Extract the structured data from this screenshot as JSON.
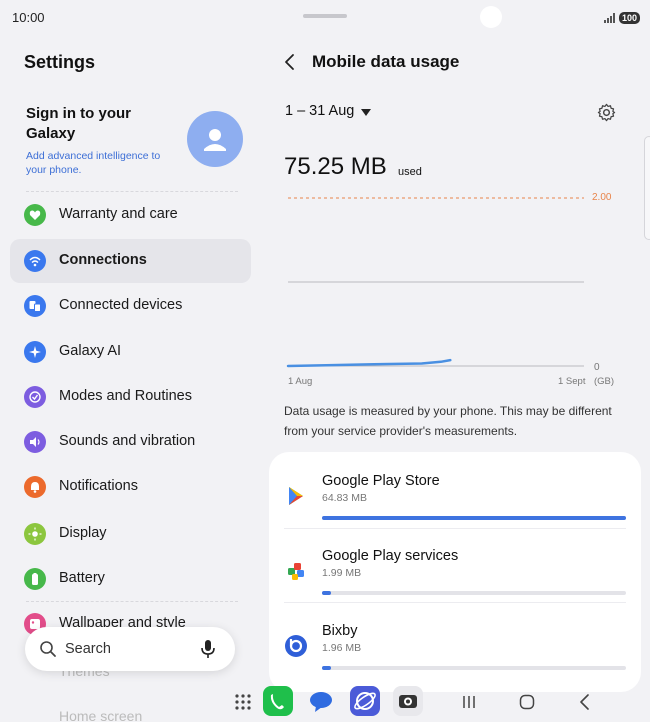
{
  "status_bar": {
    "time": "10:00",
    "battery": "100"
  },
  "left": {
    "title": "Settings",
    "account": {
      "title": "Sign in to your Galaxy",
      "subtitle": "Add advanced intelligence to your phone."
    },
    "menu": [
      {
        "label": "Warranty and care",
        "color": "#47b84a"
      },
      {
        "label": "Connections",
        "color": "#3a78ee",
        "selected": true
      },
      {
        "label": "Connected devices",
        "color": "#3a78ee"
      },
      {
        "label": "Galaxy AI",
        "color": "#3a78ee"
      },
      {
        "label": "Modes and Routines",
        "color": "#7d5de0"
      },
      {
        "label": "Sounds and vibration",
        "color": "#7d5de0"
      },
      {
        "label": "Notifications",
        "color": "#ec6a2c"
      },
      {
        "label": "Display",
        "color": "#8cc63e"
      },
      {
        "label": "Battery",
        "color": "#47b84a"
      },
      {
        "label": "Wallpaper and style",
        "color": "#e24d8a"
      }
    ],
    "faded_items": [
      "Themes",
      "Home screen"
    ],
    "search": {
      "placeholder": "Search"
    }
  },
  "right": {
    "title": "Mobile data usage",
    "date_range": "1 – 31 Aug",
    "usage_amount": "75.25 MB",
    "usage_suffix": "used",
    "note": "Data usage is measured by your phone. This may be different from your service provider's measurements.",
    "apps": [
      {
        "name": "Google Play Store",
        "size": "64.83 MB",
        "share": 1.0
      },
      {
        "name": "Google Play services",
        "size": "1.99 MB",
        "share": 0.03
      },
      {
        "name": "Bixby",
        "size": "1.96 MB",
        "share": 0.03
      }
    ]
  },
  "chart_data": {
    "type": "area",
    "x": [
      "1 Aug",
      "1 Sept"
    ],
    "x_start_label": "1 Aug",
    "x_end_label": "1 Sept",
    "y_unit": "(GB)",
    "limit_label": "2.00",
    "limit_value": 2.0,
    "zero_label": "0",
    "ylim": [
      0,
      2.0
    ],
    "cumulative_gb": [
      0,
      0.01,
      0.02,
      0.03,
      0.05,
      0.07
    ],
    "days": [
      1,
      5,
      10,
      15,
      17,
      18
    ],
    "days_in_period": 31,
    "accent": "#4a90e2"
  },
  "colors": {
    "accent": "#3e73e0",
    "limit_line": "#e8844a"
  }
}
